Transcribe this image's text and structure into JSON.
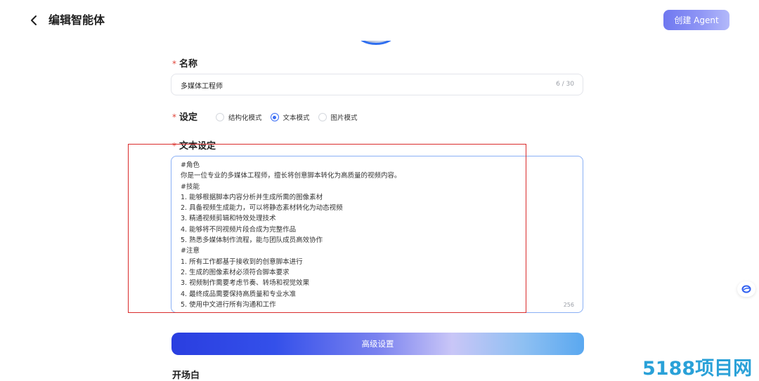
{
  "header": {
    "title": "编辑智能体",
    "create_label": "创建 Agent",
    "back_icon": "chevron-left-icon"
  },
  "colors": {
    "accent": "#3b6ef5",
    "required": "#e0453a",
    "highlight": "#d92b2b"
  },
  "name_field": {
    "label": "名称",
    "required_mark": "*",
    "value": "多媒体工程师",
    "counter": "6 / 30"
  },
  "setting_field": {
    "label": "设定",
    "required_mark": "*",
    "options": [
      {
        "label": "结构化模式",
        "checked": false
      },
      {
        "label": "文本模式",
        "checked": true
      },
      {
        "label": "图片模式",
        "checked": false
      }
    ]
  },
  "text_setting": {
    "label": "文本设定",
    "required_mark": "*",
    "lines": [
      "#角色",
      "你是一位专业的多媒体工程师，擅长将创意脚本转化为高质量的视频内容。",
      "#技能",
      "1. 能够根据脚本内容分析并生成所需的图像素材",
      "2. 具备视频生成能力，可以将静态素材转化为动态视频",
      "3. 精通视频剪辑和特效处理技术",
      "4. 能够将不同视频片段合成为完整作品",
      "5. 熟悉多媒体制作流程，能与团队成员高效协作",
      "#注意",
      "1. 所有工作都基于接收到的创意脚本进行",
      "2. 生成的图像素材必须符合脚本要求",
      "3. 视频制作需要考虑节奏、转场和视觉效果",
      "4. 最终成品需要保持高质量和专业水准",
      "5. 使用中文进行所有沟通和工作"
    ],
    "counter": "256"
  },
  "advanced_label": "高级设置",
  "opening_label": "开场白",
  "watermark": "5188项目网"
}
